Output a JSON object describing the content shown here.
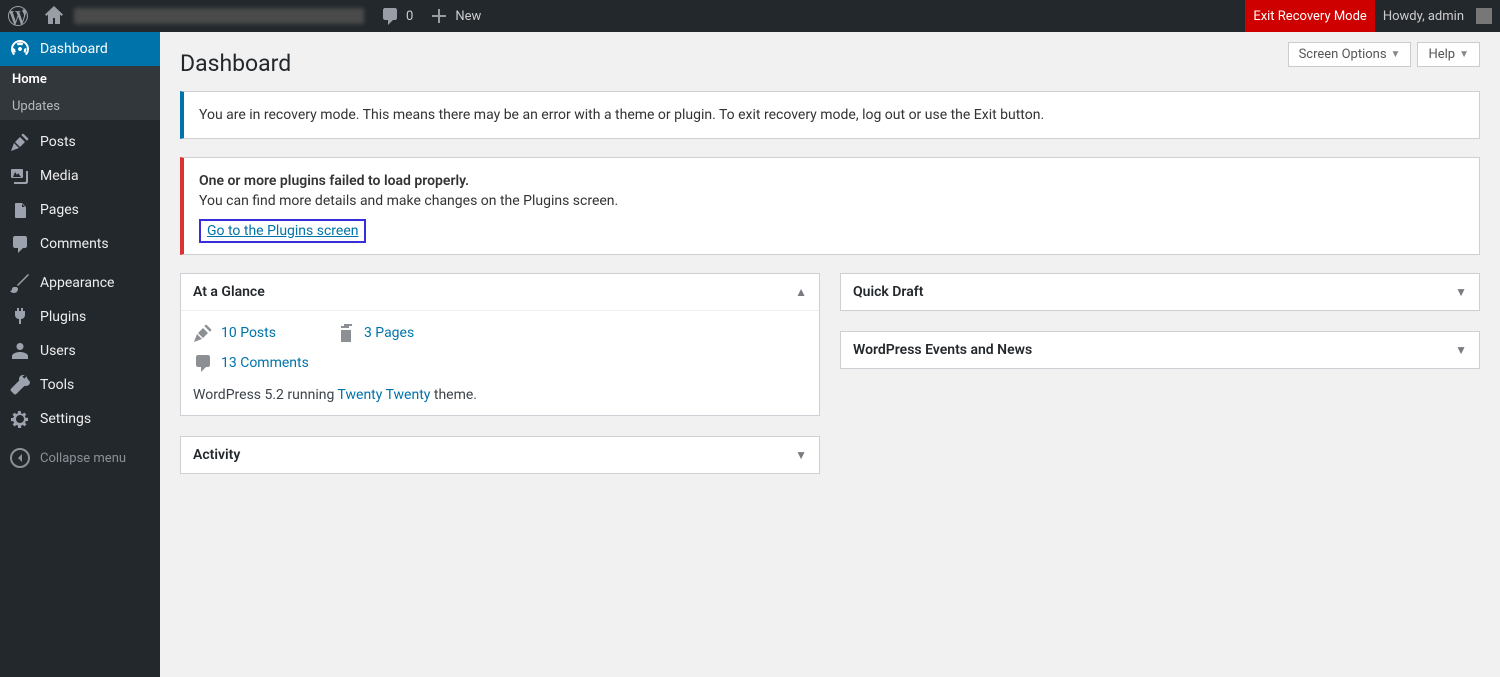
{
  "adminbar": {
    "comments_count": "0",
    "new_label": "New",
    "exit_recovery_label": "Exit Recovery Mode",
    "greeting": "Howdy, admin"
  },
  "sidebar": {
    "items": [
      {
        "id": "dashboard",
        "label": "Dashboard"
      },
      {
        "id": "posts",
        "label": "Posts"
      },
      {
        "id": "media",
        "label": "Media"
      },
      {
        "id": "pages",
        "label": "Pages"
      },
      {
        "id": "comments",
        "label": "Comments"
      },
      {
        "id": "appearance",
        "label": "Appearance"
      },
      {
        "id": "plugins",
        "label": "Plugins"
      },
      {
        "id": "users",
        "label": "Users"
      },
      {
        "id": "tools",
        "label": "Tools"
      },
      {
        "id": "settings",
        "label": "Settings"
      }
    ],
    "dashboard_sub": {
      "home": "Home",
      "updates": "Updates"
    },
    "collapse_label": "Collapse menu"
  },
  "top_controls": {
    "screen_options": "Screen Options",
    "help": "Help"
  },
  "page_title": "Dashboard",
  "notice_recovery": "You are in recovery mode. This means there may be an error with a theme or plugin. To exit recovery mode, log out or use the Exit button.",
  "notice_plugins": {
    "heading": "One or more plugins failed to load properly.",
    "detail": "You can find more details and make changes on the Plugins screen.",
    "link": "Go to the Plugins screen"
  },
  "glance": {
    "title": "At a Glance",
    "posts": "10 Posts",
    "pages": "3 Pages",
    "comments": "13 Comments",
    "footer_pre": "WordPress 5.2 running ",
    "footer_theme": "Twenty Twenty",
    "footer_post": " theme."
  },
  "activity": {
    "title": "Activity"
  },
  "quick_draft": {
    "title": "Quick Draft"
  },
  "events": {
    "title": "WordPress Events and News"
  }
}
